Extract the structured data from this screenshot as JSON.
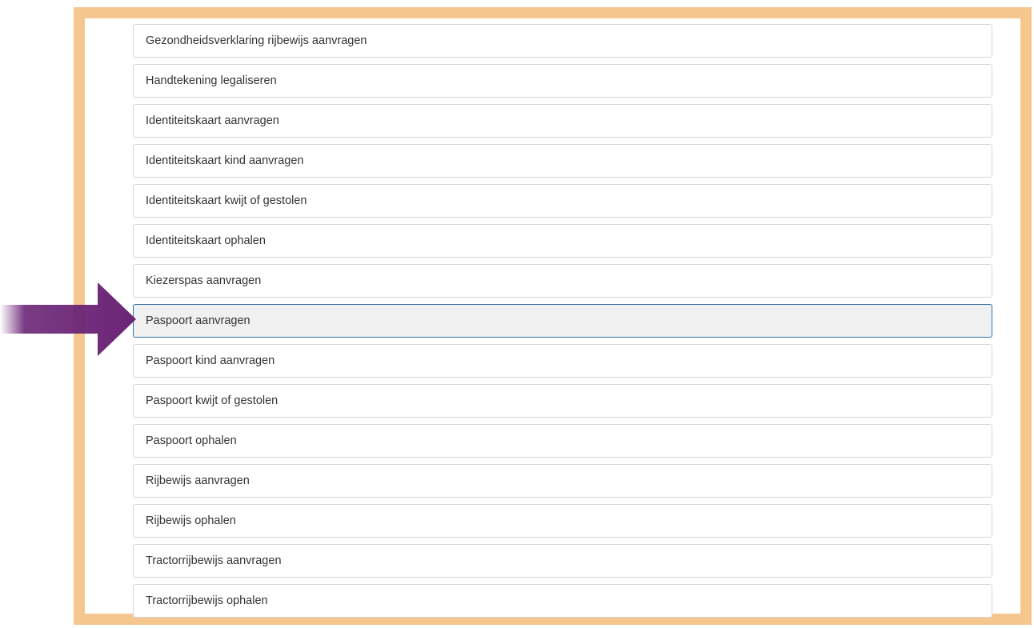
{
  "accent_color": "#f5c78f",
  "arrow_color": "#6b2576",
  "services": [
    {
      "label": "Gezondheidsverklaring rijbewijs aanvragen",
      "selected": false
    },
    {
      "label": "Handtekening legaliseren",
      "selected": false
    },
    {
      "label": "Identiteitskaart aanvragen",
      "selected": false
    },
    {
      "label": "Identiteitskaart kind aanvragen",
      "selected": false
    },
    {
      "label": "Identiteitskaart kwijt of gestolen",
      "selected": false
    },
    {
      "label": "Identiteitskaart ophalen",
      "selected": false
    },
    {
      "label": "Kiezerspas aanvragen",
      "selected": false
    },
    {
      "label": "Paspoort aanvragen",
      "selected": true
    },
    {
      "label": "Paspoort kind aanvragen",
      "selected": false
    },
    {
      "label": "Paspoort kwijt of gestolen",
      "selected": false
    },
    {
      "label": "Paspoort ophalen",
      "selected": false
    },
    {
      "label": "Rijbewijs aanvragen",
      "selected": false
    },
    {
      "label": "Rijbewijs ophalen",
      "selected": false
    },
    {
      "label": "Tractorrijbewijs aanvragen",
      "selected": false
    },
    {
      "label": "Tractorrijbewijs ophalen",
      "selected": false
    }
  ]
}
